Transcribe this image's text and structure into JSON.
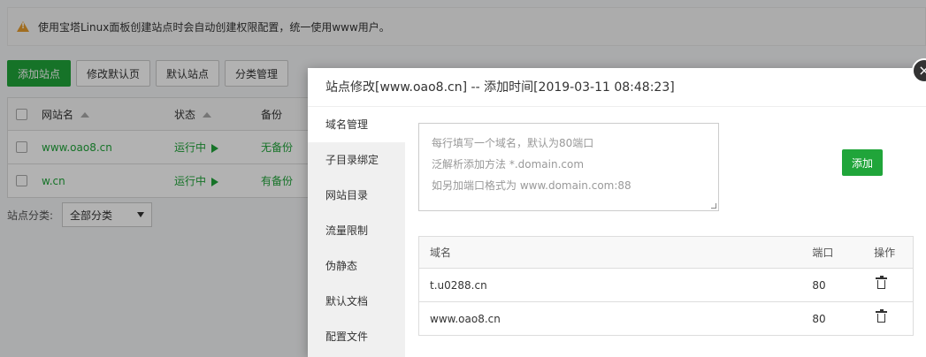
{
  "notice": {
    "text": "使用宝塔Linux面板创建站点时会自动创建权限配置，统一使用www用户。"
  },
  "toolbar": {
    "add_site": "添加站点",
    "edit_default": "修改默认页",
    "default_site": "默认站点",
    "category_mgmt": "分类管理"
  },
  "site_table": {
    "headers": {
      "name": "网站名",
      "status": "状态",
      "backup": "备份"
    },
    "rows": [
      {
        "name": "www.oao8.cn",
        "status": "运行中",
        "backup": "无备份"
      },
      {
        "name": "w.cn",
        "status": "运行中",
        "backup": "有备份"
      }
    ]
  },
  "category": {
    "label": "站点分类:",
    "selected": "全部分类"
  },
  "modal": {
    "title": "站点修改[www.oao8.cn] -- 添加时间[2019-03-11 08:48:23]",
    "close": "×",
    "tabs": [
      "域名管理",
      "子目录绑定",
      "网站目录",
      "流量限制",
      "伪静态",
      "默认文档",
      "配置文件"
    ],
    "textarea_lines": [
      "每行填写一个域名，默认为80端口",
      "泛解析添加方法 *.domain.com",
      "如另加端口格式为 www.domain.com:88"
    ],
    "add_button": "添加",
    "domain_table": {
      "headers": {
        "domain": "域名",
        "port": "端口",
        "op": "操作"
      },
      "rows": [
        {
          "domain": "t.u0288.cn",
          "port": "80"
        },
        {
          "domain": "www.oao8.cn",
          "port": "80"
        }
      ]
    }
  },
  "colors": {
    "accent": "#20a53a",
    "warning": "#e69d2e"
  }
}
